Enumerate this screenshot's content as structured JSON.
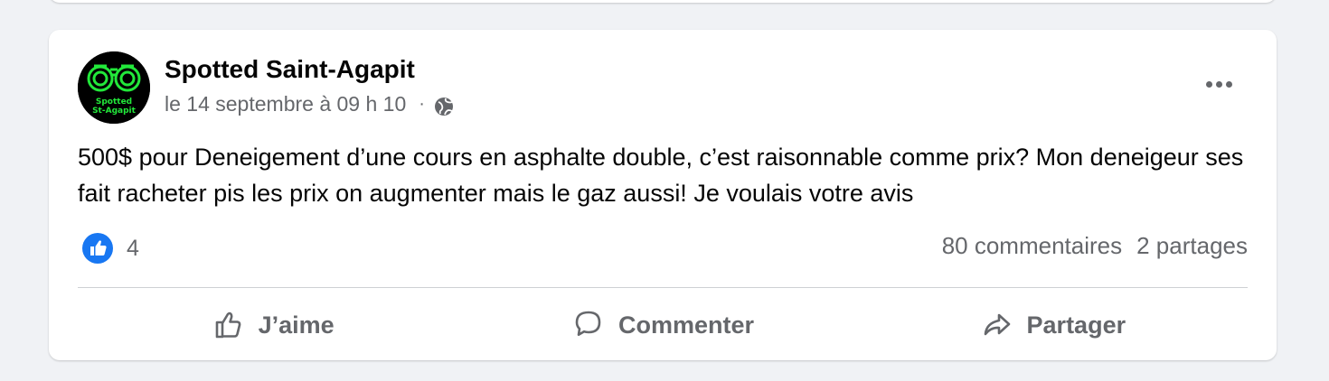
{
  "colors": {
    "page_bg": "#f0f2f5",
    "card_bg": "#ffffff",
    "primary_text": "#050505",
    "secondary_text": "#65676b",
    "like_blue": "#1877f2",
    "logo_green": "#22e83a",
    "divider": "#ced0d4"
  },
  "post": {
    "page_name": "Spotted Saint-Agapit",
    "avatar": {
      "icon": "binoculars-logo",
      "line1": "Spotted",
      "line2": "St-Agapit"
    },
    "date": "le 14 septembre à 09 h 10",
    "separator": "·",
    "audience_icon": "globe-icon",
    "more_icon": "more-options-icon",
    "text": "500$ pour Deneigement d’une cours en asphalte double, c’est raisonnable comme prix? Mon deneigeur ses fait racheter pis les prix on augmenter mais le gaz aussi! Je voulais votre avis",
    "reactions": {
      "icon": "like-reaction-icon",
      "count": "4"
    },
    "comments_count": "80 commentaires",
    "shares_count": "2 partages"
  },
  "actions": {
    "like": {
      "label": "J’aime",
      "icon": "thumbs-up-icon"
    },
    "comment": {
      "label": "Commenter",
      "icon": "comment-icon"
    },
    "share": {
      "label": "Partager",
      "icon": "share-icon"
    }
  }
}
